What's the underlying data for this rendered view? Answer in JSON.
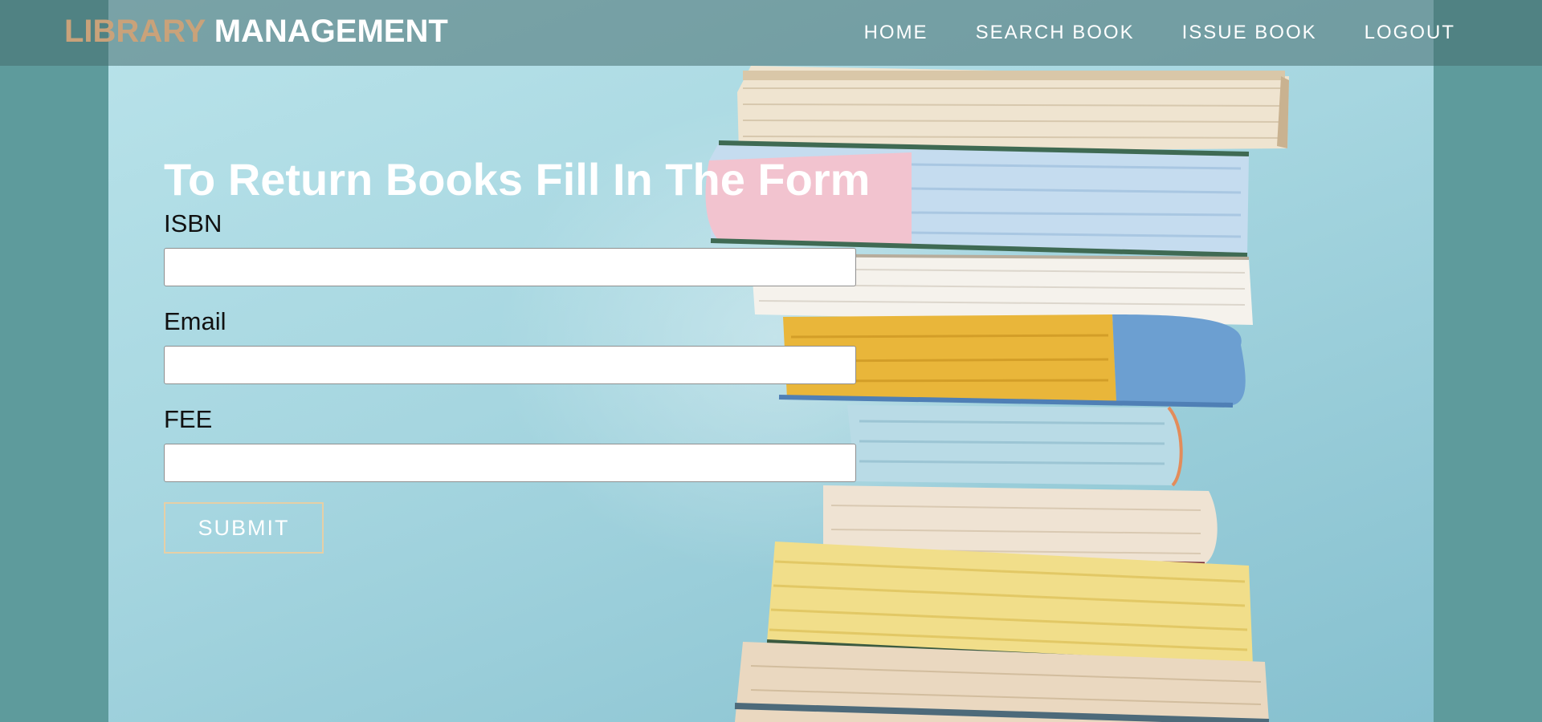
{
  "brand": {
    "part1": "LIBRARY",
    "part2": "MANAGEMENT"
  },
  "nav": {
    "items": [
      {
        "label": "HOME"
      },
      {
        "label": "SEARCH BOOK"
      },
      {
        "label": "ISSUE BOOK"
      },
      {
        "label": "LOGOUT"
      }
    ]
  },
  "form": {
    "title": "To Return Books Fill In The Form",
    "fields": [
      {
        "label": "ISBN",
        "value": ""
      },
      {
        "label": "Email",
        "value": ""
      },
      {
        "label": "FEE",
        "value": ""
      }
    ],
    "submit_label": "SUBMIT"
  },
  "colors": {
    "page_background": "#5e9b9c",
    "brand_accent": "#c9a27a",
    "button_border": "#e6cfa6",
    "navbar": "rgba(70,110,112,0.55)"
  },
  "background_image": "stack-of-books"
}
